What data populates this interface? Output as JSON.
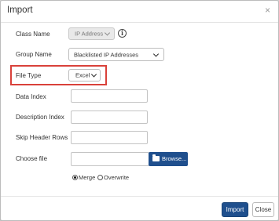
{
  "dialog": {
    "title": "Import",
    "close_icon": "×"
  },
  "form": {
    "class_name": {
      "label": "Class Name",
      "value": "IP Address",
      "info_icon": "i"
    },
    "group_name": {
      "label": "Group Name",
      "value": "Blacklisted IP Addresses"
    },
    "file_type": {
      "label": "File Type",
      "value": "Excel"
    },
    "data_index": {
      "label": "Data Index",
      "value": ""
    },
    "description_index": {
      "label": "Description Index",
      "value": ""
    },
    "skip_header_rows": {
      "label": "Skip Header Rows",
      "value": ""
    },
    "choose_file": {
      "label": "Choose file",
      "value": "",
      "browse_label": "Browse..."
    },
    "mode": {
      "options": [
        "Merge",
        "Overwrite"
      ],
      "selected": "Merge"
    }
  },
  "footer": {
    "import_label": "Import",
    "close_label": "Close"
  },
  "colors": {
    "primary": "#1f4f8d",
    "highlight": "#d9413a"
  }
}
